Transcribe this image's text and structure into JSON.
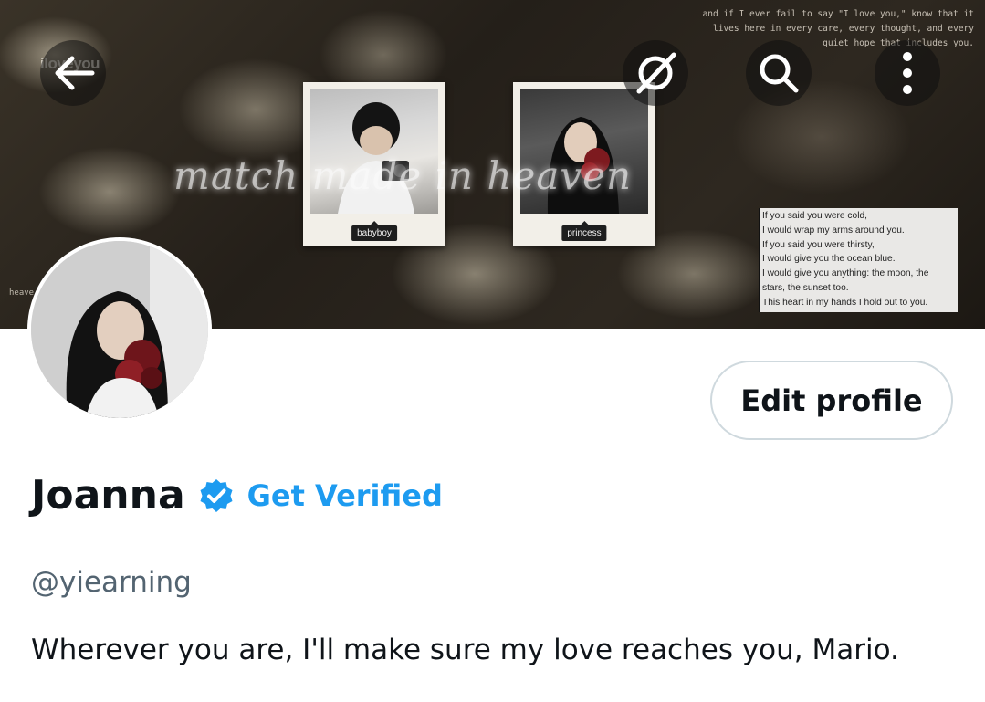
{
  "banner": {
    "quote": "and if I ever fail to say \"I love you,\" know that it lives here in every care, every thought, and every quiet hope that includes you.",
    "tag": "iloveyou",
    "side_text": "heave on",
    "script_text": "match made in heaven",
    "polaroids": [
      {
        "label": "babyboy"
      },
      {
        "label": "princess"
      }
    ],
    "poem_lines": [
      "If you said you were cold,",
      "I would wrap my arms around you.",
      "If you said you were thirsty,",
      "I would give you the ocean blue.",
      "I would give you anything: the moon, the",
      "stars, the sunset too.",
      "This heart in my hands I hold out to you."
    ]
  },
  "nav": {
    "back_icon": "arrow-left-icon",
    "grok_icon": "grok-icon",
    "search_icon": "search-icon",
    "more_icon": "more-vertical-icon"
  },
  "profile": {
    "edit_label": "Edit profile",
    "name": "Joanna",
    "verified_icon": "verified-badge-icon",
    "get_verified": "Get Verified",
    "handle": "@yiearning",
    "bio": "Wherever you are, I'll make sure my love reaches you, Mario."
  },
  "colors": {
    "accent": "#1d9bf0",
    "text": "#0f1419",
    "muted": "#536471",
    "border": "#cfd9de"
  }
}
